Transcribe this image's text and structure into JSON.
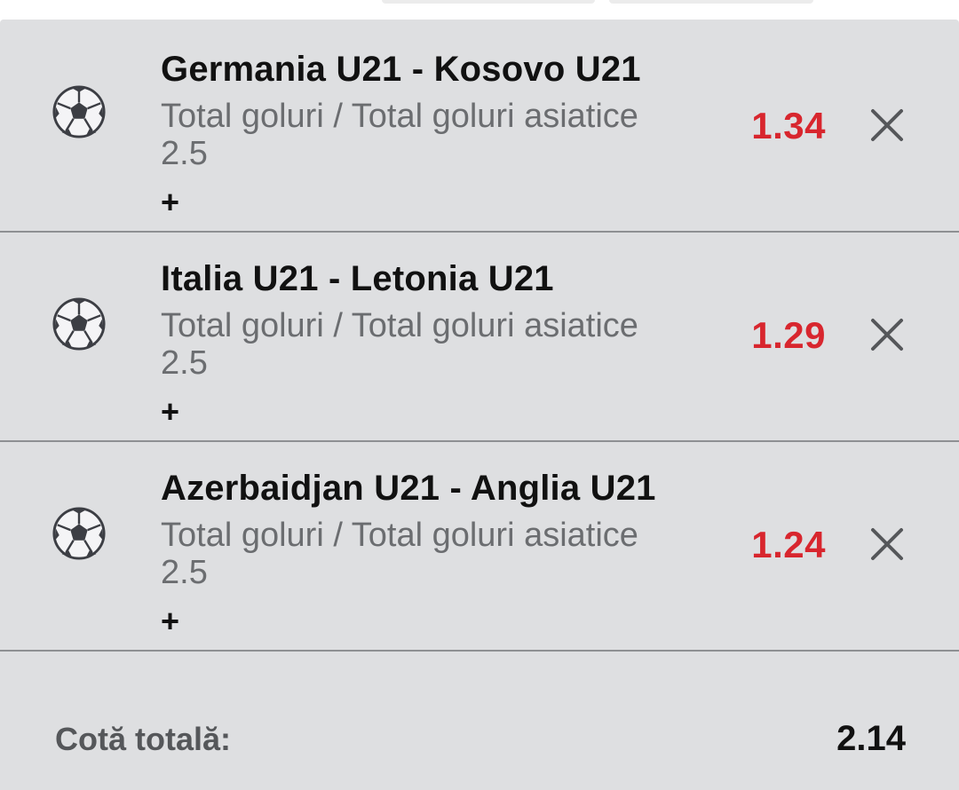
{
  "bet_slip": {
    "selections": [
      {
        "match": "Germania U21 - Kosovo U21",
        "market": "Total goluri / Total goluri asiatice",
        "line": "2.5",
        "odds": "1.34",
        "expand_label": "+",
        "sport_icon": "soccer-ball-icon",
        "remove_icon": "close-icon"
      },
      {
        "match": "Italia U21 - Letonia U21",
        "market": "Total goluri / Total goluri asiatice",
        "line": "2.5",
        "odds": "1.29",
        "expand_label": "+",
        "sport_icon": "soccer-ball-icon",
        "remove_icon": "close-icon"
      },
      {
        "match": "Azerbaidjan U21 - Anglia U21",
        "market": "Total goluri / Total goluri asiatice",
        "line": "2.5",
        "odds": "1.24",
        "expand_label": "+",
        "sport_icon": "soccer-ball-icon",
        "remove_icon": "close-icon"
      }
    ],
    "total_label": "Cotă totală:",
    "total_odds": "2.14"
  },
  "colors": {
    "background": "#dedfe1",
    "odds": "#d8262e",
    "divider": "#8e9093",
    "market_text": "#6b6d70"
  }
}
